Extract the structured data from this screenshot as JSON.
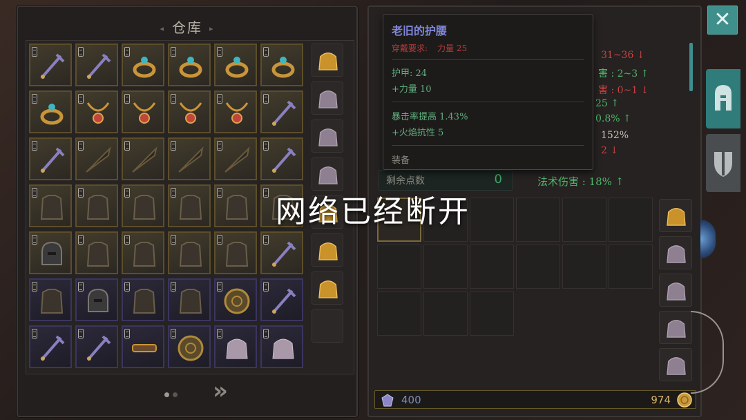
{
  "storage": {
    "title": "仓库"
  },
  "grid": {
    "rows": [
      [
        "gold",
        "gold",
        "gold",
        "gold",
        "gold",
        "gold"
      ],
      [
        "gold",
        "gold",
        "gold",
        "gold",
        "gold",
        "gold"
      ],
      [
        "gold",
        "gold",
        "gold",
        "gold",
        "gold",
        "gold"
      ],
      [
        "gold",
        "gold",
        "gold",
        "gold",
        "gold",
        "gold"
      ],
      [
        "gold",
        "gold",
        "gold",
        "gold",
        "gold",
        "gold"
      ],
      [
        "blue",
        "blue",
        "blue",
        "blue",
        "blue",
        "blue"
      ],
      [
        "blue",
        "blue",
        "blue",
        "blue",
        "blue",
        "blue"
      ]
    ]
  },
  "pager": {
    "pages": 2,
    "current": 1
  },
  "tooltip": {
    "name": "老旧的护腰",
    "requirement_label": "穿戴要求:",
    "requirement_value": "力量 25",
    "armor": "护甲:  24",
    "strength": "+力量 10",
    "crit": "暴击率提高  1.43%",
    "fire_res": "+火焰抗性  5",
    "type": "装备"
  },
  "stats": {
    "s1": "31~36 ↓",
    "s2": "害 : 2~3  ↑",
    "s3": "害 : 0~1  ↓",
    "s4": "25 ↑",
    "s5": "0.8% ↑",
    "s6": "152%",
    "s7": "2 ↓"
  },
  "points": {
    "label": "剩余点数",
    "value": "0"
  },
  "magic": {
    "label": "法术伤害 : 18% ↑"
  },
  "currency": {
    "gems": "400",
    "gold": "974"
  },
  "overlay": {
    "message": "网络已经断开"
  },
  "colors": {
    "accent": "#3f8f8c",
    "gold_border": "#5c4e2a",
    "blue_border": "#3a3560",
    "up": "#4fb86a",
    "down": "#c94242",
    "item_name": "#7f86d9"
  }
}
